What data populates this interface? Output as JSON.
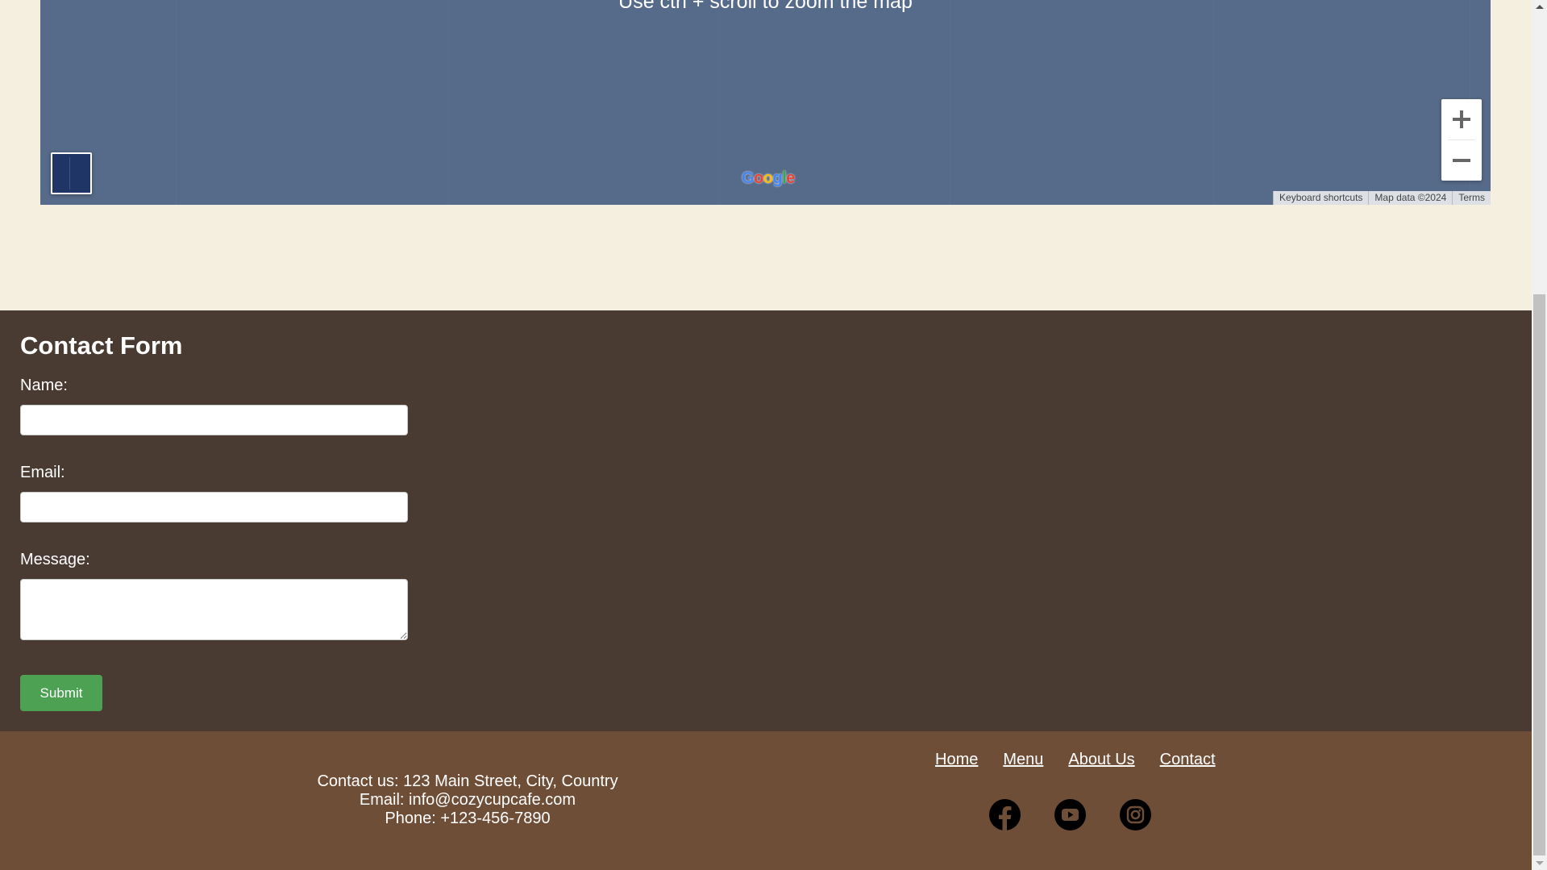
{
  "map": {
    "hint": "Use ctrl + scroll to zoom the map",
    "logo_text": "Google",
    "logo_colors": [
      "#4285F4",
      "#EA4335",
      "#FBBC05",
      "#4285F4",
      "#34A853",
      "#EA4335"
    ],
    "zoom_in_icon": "plus-icon",
    "zoom_out_icon": "minus-icon",
    "attribution": {
      "keyboard_shortcuts": "Keyboard shortcuts",
      "map_data": "Map data ©2024",
      "terms": "Terms"
    }
  },
  "contact_form": {
    "title": "Contact Form",
    "name_label": "Name:",
    "name_value": "",
    "email_label": "Email:",
    "email_value": "",
    "message_label": "Message:",
    "message_value": "",
    "submit_label": "Submit"
  },
  "footer": {
    "contact_line": "Contact us: 123 Main Street, City, Country",
    "email_line": "Email: info@cozycupcafe.com",
    "phone_line": "Phone: +123-456-7890",
    "nav": [
      {
        "label": "Home"
      },
      {
        "label": "Menu"
      },
      {
        "label": "About Us"
      },
      {
        "label": "Contact"
      }
    ],
    "social_icons": [
      "facebook-icon",
      "youtube-icon",
      "instagram-icon"
    ]
  },
  "colors": {
    "page_bg": "#f5efdf",
    "map_bg": "#566a89",
    "form_bg": "#4a3b32",
    "footer_bg": "#6f4e37",
    "submit_bg": "#4ca153"
  }
}
